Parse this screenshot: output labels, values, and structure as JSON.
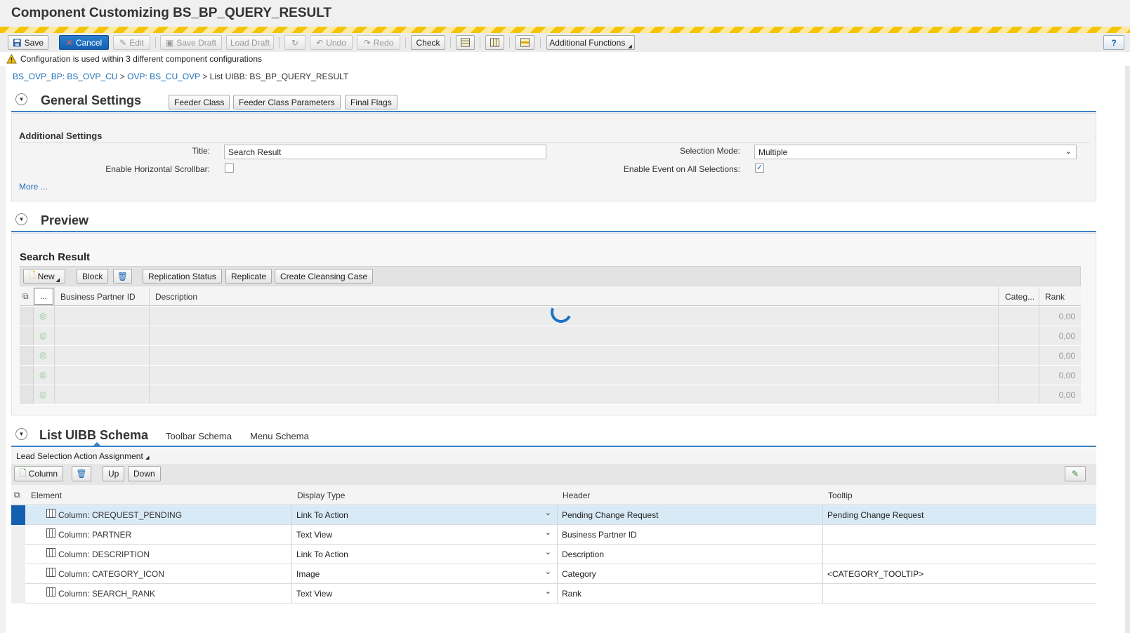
{
  "window": {
    "title": "Component Customizing BS_BP_QUERY_RESULT"
  },
  "toolbar": {
    "save": "Save",
    "cancel": "Cancel",
    "edit": "Edit",
    "save_draft": "Save Draft",
    "load_draft": "Load Draft",
    "undo": "Undo",
    "redo": "Redo",
    "check": "Check",
    "additional_functions": "Additional Functions",
    "help": "?"
  },
  "message": {
    "text": "Configuration is used within 3 different component configurations",
    "icon": "warning-icon"
  },
  "breadcrumb": {
    "items": [
      "BS_OVP_BP: BS_OVP_CU",
      "OVP: BS_CU_OVP",
      "List UIBB: BS_BP_QUERY_RESULT"
    ],
    "separator": ">"
  },
  "general_settings": {
    "title": "General Settings",
    "buttons": [
      "Feeder Class",
      "Feeder Class Parameters",
      "Final Flags"
    ],
    "additional_settings_title": "Additional Settings",
    "title_label": "Title:",
    "title_value": "Search Result",
    "hscroll_label": "Enable Horizontal Scrollbar:",
    "hscroll_checked": false,
    "selection_mode_label": "Selection Mode:",
    "selection_mode_value": "Multiple",
    "event_label": "Enable Event on All Selections:",
    "event_checked": true,
    "more": "More ..."
  },
  "preview": {
    "title": "Preview",
    "list_title": "Search Result",
    "toolbar": {
      "new": "New",
      "block": "Block",
      "replication_status": "Replication Status",
      "replicate": "Replicate",
      "create_cleansing_case": "Create Cleansing Case"
    },
    "columns": {
      "selector": "...",
      "bp_id": "Business Partner ID",
      "description": "Description",
      "category": "Categ...",
      "rank": "Rank"
    },
    "rows": [
      {
        "rank": "0,00"
      },
      {
        "rank": "0,00"
      },
      {
        "rank": "0,00"
      },
      {
        "rank": "0,00"
      },
      {
        "rank": "0,00"
      }
    ]
  },
  "schema": {
    "title": "List UIBB Schema",
    "tabs": [
      "Toolbar Schema",
      "Menu Schema"
    ],
    "lead_selection": "Lead Selection Action Assignment",
    "toolbar": {
      "column": "Column",
      "up": "Up",
      "down": "Down"
    },
    "columns": {
      "element": "Element",
      "display_type": "Display Type",
      "header": "Header",
      "tooltip": "Tooltip"
    },
    "rows": [
      {
        "element": "Column: CREQUEST_PENDING",
        "display_type": "Link To Action",
        "header": "Pending Change Request",
        "tooltip": "Pending Change Request",
        "selected": true
      },
      {
        "element": "Column: PARTNER",
        "display_type": "Text View",
        "header": "Business Partner ID",
        "tooltip": ""
      },
      {
        "element": "Column: DESCRIPTION",
        "display_type": "Link To Action",
        "header": "Description",
        "tooltip": ""
      },
      {
        "element": "Column: CATEGORY_ICON",
        "display_type": "Image",
        "header": "Category",
        "tooltip": "<CATEGORY_TOOLTIP>"
      },
      {
        "element": "Column: SEARCH_RANK",
        "display_type": "Text View",
        "header": "Rank",
        "tooltip": ""
      }
    ]
  },
  "colors": {
    "accent": "#1460b0",
    "link": "#1f6fb8",
    "warning_stripe": "#f4c400",
    "selected_row": "#d9eaf7"
  }
}
